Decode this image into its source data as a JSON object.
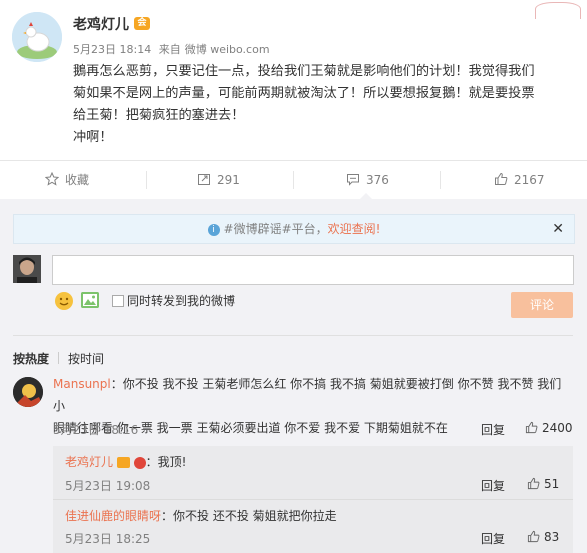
{
  "post": {
    "author": "老鸡灯儿",
    "vip_badge": "会",
    "date": "5月23日 18:14",
    "source_prefix": "来自",
    "source": "微博 weibo.com",
    "text_line1": "鵝再怎么恶剪，只要记住一点，投给我们王菊就是影响他们的计划！我觉得我们",
    "text_line2": "菊如果不是网上的声量，可能前两期就被淘汰了！所以要想报复鵝！就是要投票",
    "text_line3": "给王菊！把菊疯狂的塞进去！",
    "text_line4": "冲啊！"
  },
  "actions": {
    "favorite_label": "收藏",
    "repost_count": "291",
    "comment_count": "376",
    "like_count": "2167"
  },
  "comment_box": {
    "notice_prefix": "#微博辟谣#平台，",
    "notice_link": "欢迎查阅!",
    "input_value": "",
    "also_repost_label": "同时转发到我的微博",
    "submit_label": "评论"
  },
  "sort": {
    "by_hot": "按热度",
    "by_time": "按时间"
  },
  "comments": [
    {
      "user": "Mansunpl",
      "text": "：你不投 我不投 王菊老师怎么红 你不搞 我不搞 菊姐就要被打倒 你不赞 我不赞 我们小",
      "text2": "眼睛往哪看 你一票 我一票 王菊必须要出道 你不爱 我不爱 下期菊姐就不在",
      "time": "5月23日 18:16",
      "reply_label": "回复",
      "likes": "2400"
    }
  ],
  "replies": [
    {
      "user": "老鸡灯儿",
      "text": "：我顶!",
      "time": "5月23日 19:08",
      "reply_label": "回复",
      "likes": "51"
    },
    {
      "user": "佳进仙鹿的眼睛呀",
      "text": "：你不投 还不投 菊姐就把你拉走",
      "time": "5月23日 18:25",
      "reply_label": "回复",
      "likes": "83"
    }
  ],
  "colors": {
    "accent": "#eb7350",
    "meta": "#808080",
    "panel": "#f2f2f5"
  }
}
